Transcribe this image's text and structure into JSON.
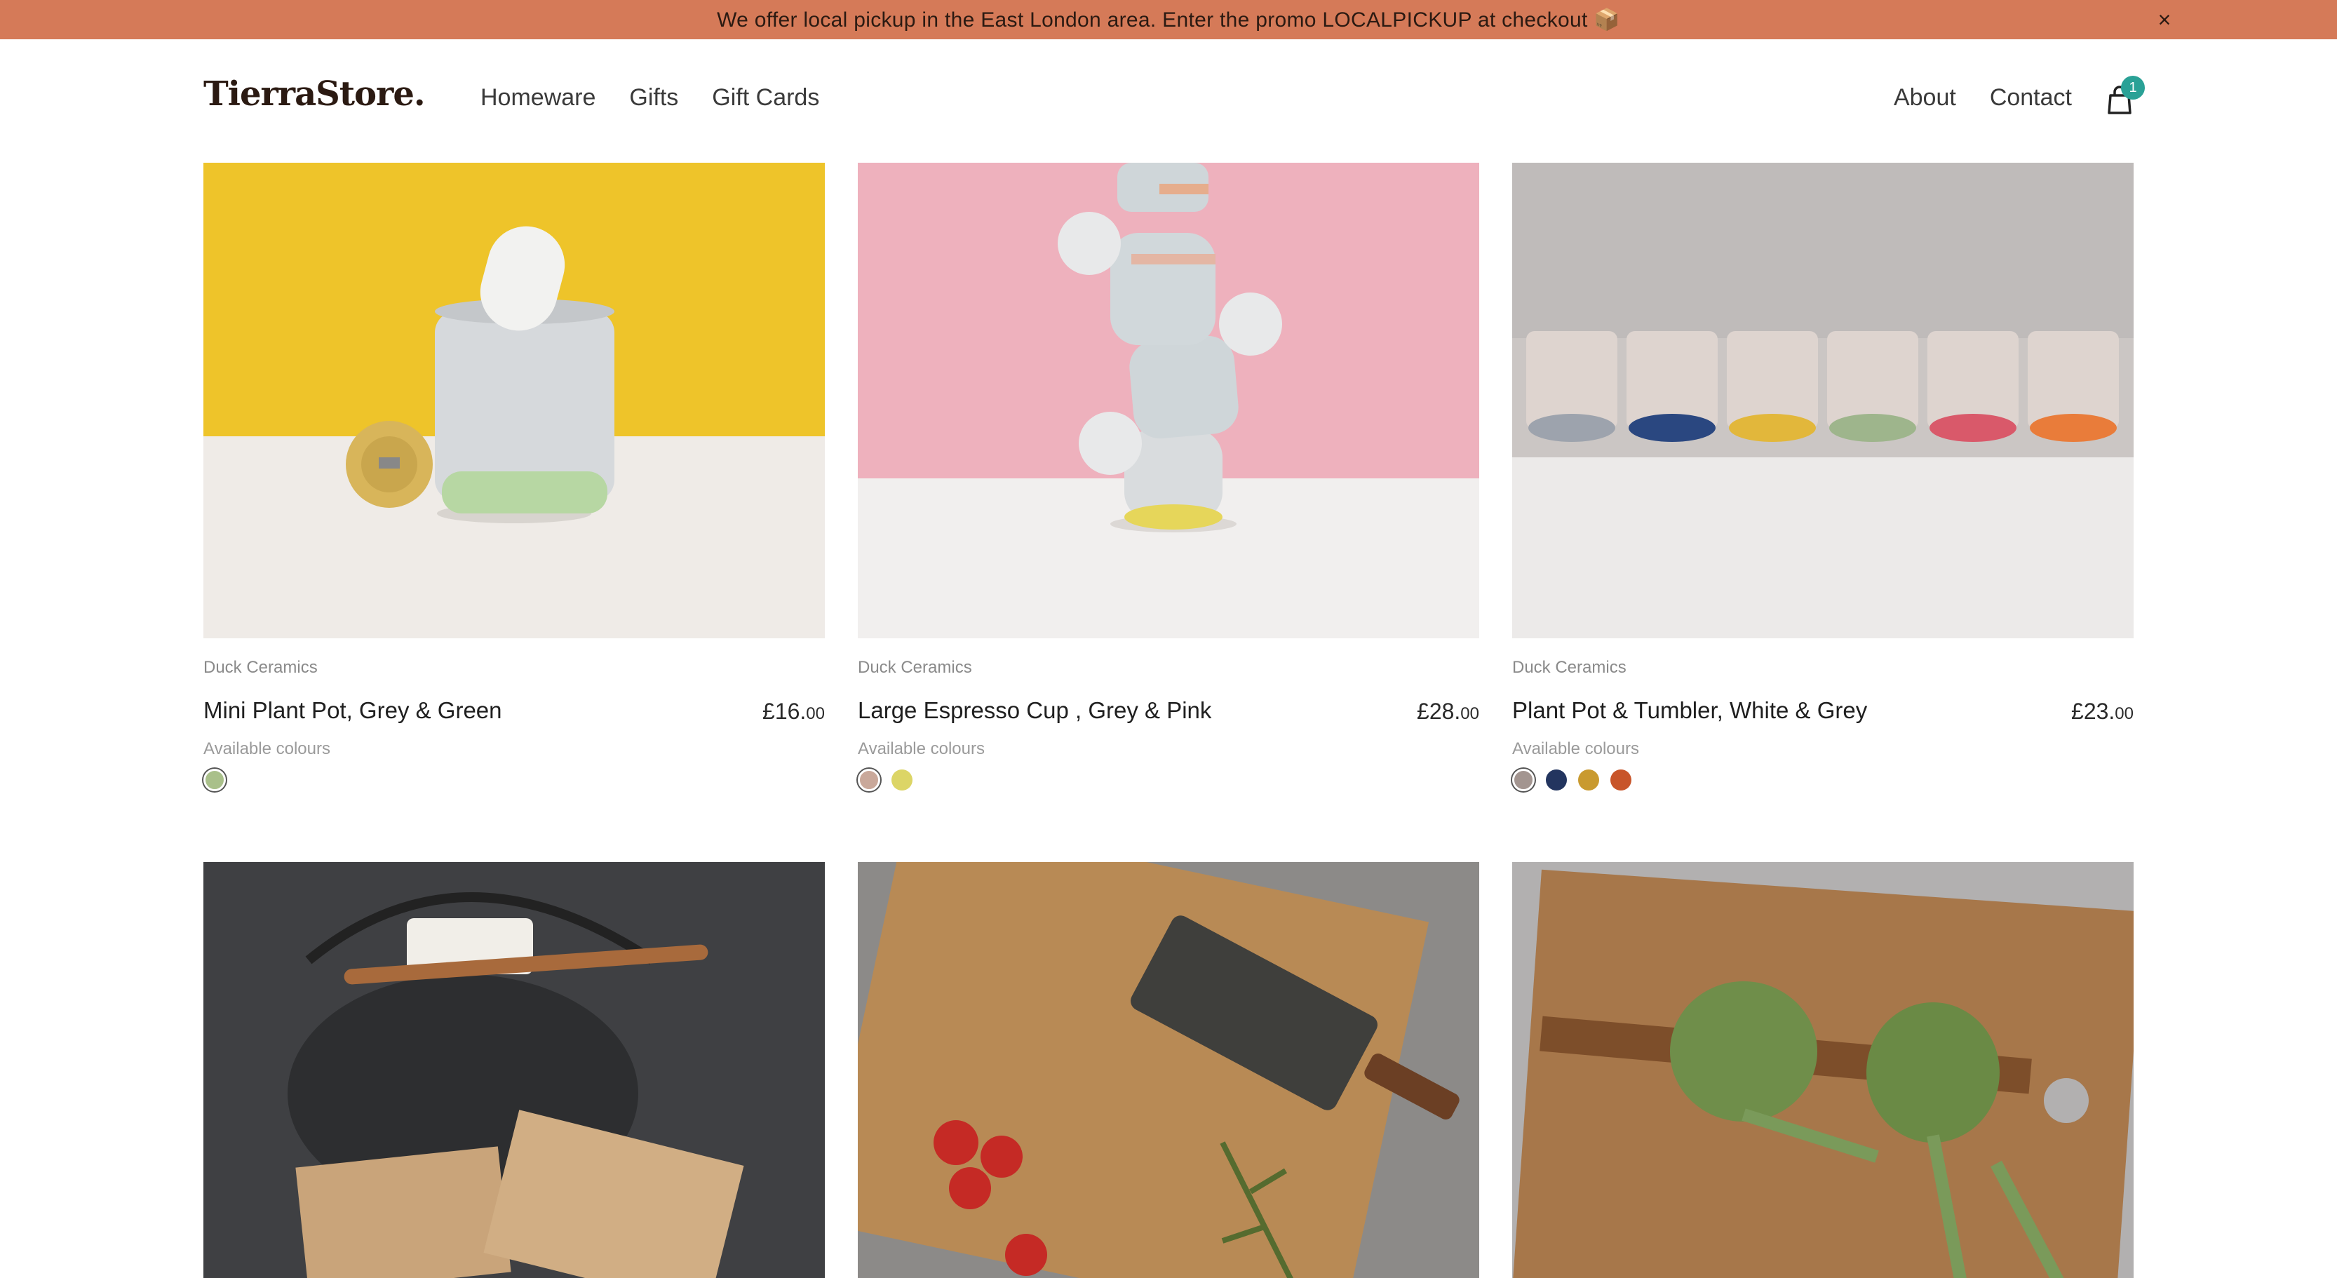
{
  "promo": {
    "text": "We offer local pickup in the East London area. Enter the promo LOCALPICKUP at checkout 📦",
    "close_label": "×"
  },
  "header": {
    "logo": "TierraStore.",
    "nav_left": [
      "Homeware",
      "Gifts",
      "Gift Cards"
    ],
    "nav_right": [
      "About",
      "Contact"
    ],
    "cart_count": "1"
  },
  "colors": {
    "promo_bg": "#d57a58",
    "badge": "#2aa196"
  },
  "products": [
    {
      "brand": "Duck Ceramics",
      "title": "Mini Plant Pot, Grey & Green",
      "price_main": "£16.",
      "price_pence": "00",
      "available_label": "Available colours",
      "swatches": [
        "#a9c08a"
      ],
      "image": "mini-plant-pot-yellow-background"
    },
    {
      "brand": "Duck Ceramics",
      "title": "Large Espresso Cup , Grey & Pink",
      "price_main": "£28.",
      "price_pence": "00",
      "available_label": "Available colours",
      "swatches": [
        "#c9a89a",
        "#dcd566"
      ],
      "image": "stacked-espresso-cups-pink-background"
    },
    {
      "brand": "Duck Ceramics",
      "title": "Plant Pot & Tumbler, White & Grey",
      "price_main": "£23.",
      "price_pence": "00",
      "available_label": "Available colours",
      "swatches": [
        "#a39590",
        "#23355f",
        "#c99a30",
        "#c8552a"
      ],
      "image": "row-of-tumblers-grey-background"
    },
    {
      "image": "cast-iron-teapot-with-tea-bags"
    },
    {
      "image": "oak-chopping-board-with-knife-and-tomatoes"
    },
    {
      "image": "wood-board-with-artichokes"
    }
  ]
}
